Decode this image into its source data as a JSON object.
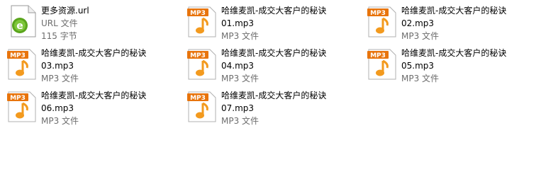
{
  "files": [
    {
      "line1": "更多资源.url",
      "line2": "",
      "type": "URL 文件",
      "size": "115 字节",
      "icon": "url-file-icon"
    },
    {
      "line1": "哈维麦凯-成交大客户的秘诀",
      "line2": "01.mp3",
      "type": "MP3 文件",
      "size": "",
      "icon": "mp3-file-icon"
    },
    {
      "line1": "哈维麦凯-成交大客户的秘诀",
      "line2": "02.mp3",
      "type": "MP3 文件",
      "size": "",
      "icon": "mp3-file-icon"
    },
    {
      "line1": "哈维麦凯-成交大客户的秘诀",
      "line2": "03.mp3",
      "type": "MP3 文件",
      "size": "",
      "icon": "mp3-file-icon"
    },
    {
      "line1": "哈维麦凯-成交大客户的秘诀",
      "line2": "04.mp3",
      "type": "MP3 文件",
      "size": "",
      "icon": "mp3-file-icon"
    },
    {
      "line1": "哈维麦凯-成交大客户的秘诀",
      "line2": "05.mp3",
      "type": "MP3 文件",
      "size": "",
      "icon": "mp3-file-icon"
    },
    {
      "line1": "哈维麦凯-成交大客户的秘诀",
      "line2": "06.mp3",
      "type": "MP3 文件",
      "size": "",
      "icon": "mp3-file-icon"
    },
    {
      "line1": "哈维麦凯-成交大客户的秘诀",
      "line2": "07.mp3",
      "type": "MP3 文件",
      "size": "",
      "icon": "mp3-file-icon"
    }
  ],
  "colors": {
    "mp3_badge": "#e8740c",
    "mp3_note": "#f39a1e",
    "url_e": "#5aa51c",
    "meta_text": "#6d6d6d"
  }
}
